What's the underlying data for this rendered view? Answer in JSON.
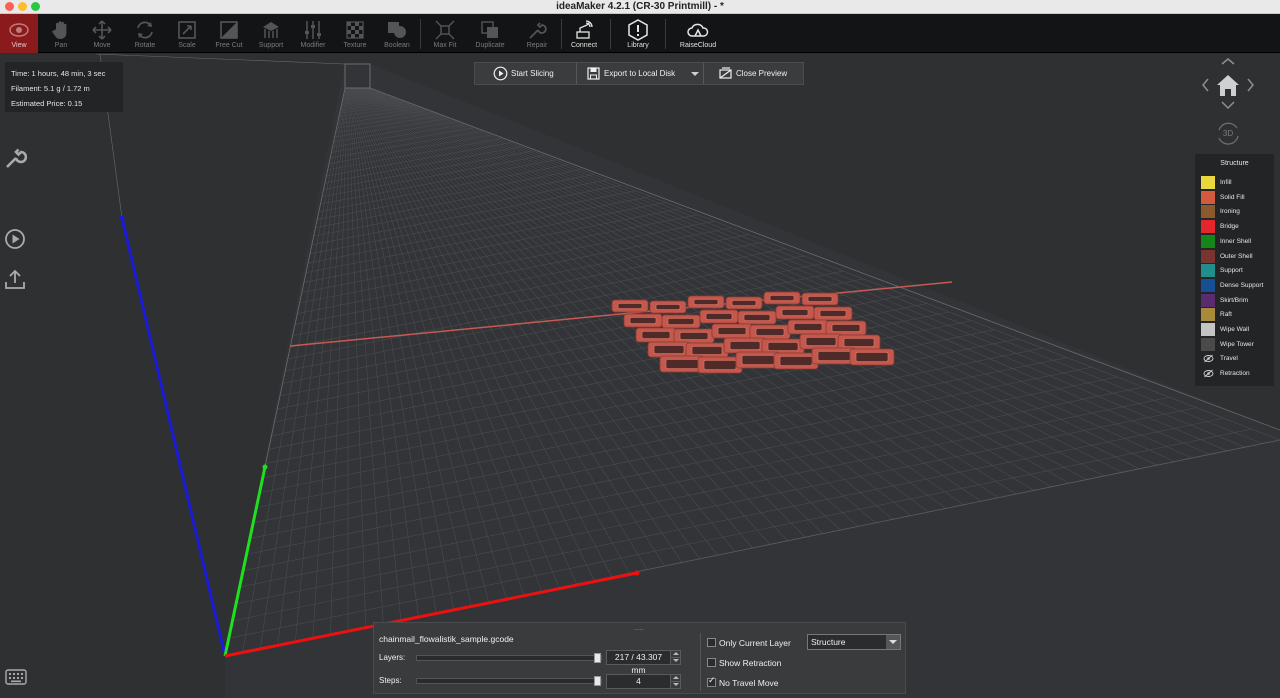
{
  "window": {
    "title": "ideaMaker 4.2.1 (CR-30 Printmill) - *"
  },
  "toolbar": {
    "tools": [
      {
        "label": "View",
        "icon": "eye-icon"
      },
      {
        "label": "Pan",
        "icon": "hand-icon"
      },
      {
        "label": "Move",
        "icon": "move-arrows-icon"
      },
      {
        "label": "Rotate",
        "icon": "rotate-icon"
      },
      {
        "label": "Scale",
        "icon": "scale-icon"
      },
      {
        "label": "Free Cut",
        "icon": "cut-icon"
      },
      {
        "label": "Support",
        "icon": "support-icon"
      },
      {
        "label": "Modifier",
        "icon": "sliders-icon"
      },
      {
        "label": "Texture",
        "icon": "checker-icon"
      },
      {
        "label": "Boolean",
        "icon": "boolean-icon"
      },
      {
        "label": "Max Fit",
        "icon": "max-fit-icon"
      },
      {
        "label": "Duplicate",
        "icon": "duplicate-icon"
      },
      {
        "label": "Repair",
        "icon": "wrench-icon"
      },
      {
        "label": "Connect",
        "icon": "connect-icon"
      },
      {
        "label": "Library",
        "icon": "library-icon"
      },
      {
        "label": "RaiseCloud",
        "icon": "cloud-icon"
      }
    ]
  },
  "info": {
    "time": "Time: 1 hours, 48 min, 3 sec",
    "filament": "Filament: 5.1 g / 1.72 m",
    "price": "Estimated Price: 0.15"
  },
  "actions": {
    "start_slicing": "Start Slicing",
    "export": "Export to Local Disk",
    "close_preview": "Close Preview"
  },
  "nav": {
    "label_3d": "3D"
  },
  "legend": {
    "title": "Structure",
    "items": [
      {
        "label": "Infill",
        "color": "#e9d73d"
      },
      {
        "label": "Solid Fill",
        "color": "#d35a3c"
      },
      {
        "label": "Ironing",
        "color": "#8a5a2e"
      },
      {
        "label": "Bridge",
        "color": "#e3262b"
      },
      {
        "label": "Inner Shell",
        "color": "#15861a"
      },
      {
        "label": "Outer Shell",
        "color": "#7a3430"
      },
      {
        "label": "Support",
        "color": "#1e8f8c"
      },
      {
        "label": "Dense Support",
        "color": "#164f93"
      },
      {
        "label": "Skirt/Brim",
        "color": "#5b2b70"
      },
      {
        "label": "Raft",
        "color": "#a88a3a"
      },
      {
        "label": "Wipe Wall",
        "color": "#c4c4c4"
      },
      {
        "label": "Wipe Tower",
        "color": "#4a4a4a"
      },
      {
        "label": "Travel",
        "color": "eye-icon"
      },
      {
        "label": "Retraction",
        "color": "eye-icon"
      }
    ]
  },
  "bottom": {
    "grip": ".....",
    "filename": "chainmail_flowalistik_sample.gcode",
    "layers_label": "Layers:",
    "layers_value": "217 / 43.307 mm",
    "layers_fraction": 1.0,
    "steps_label": "Steps:",
    "steps_value": "4",
    "steps_fraction": 1.0,
    "only_current_layer": {
      "label": "Only Current Layer",
      "checked": false
    },
    "show_retraction": {
      "label": "Show Retraction",
      "checked": false
    },
    "no_travel_move": {
      "label": "No Travel Move",
      "checked": true
    },
    "view_mode": "Structure"
  }
}
